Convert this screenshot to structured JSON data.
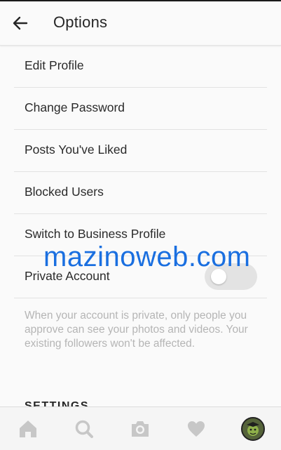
{
  "header": {
    "title": "Options",
    "back_icon": "arrow-left-icon"
  },
  "menu": {
    "items": [
      {
        "label": "Edit Profile"
      },
      {
        "label": "Change Password"
      },
      {
        "label": "Posts You've Liked"
      },
      {
        "label": "Blocked Users"
      },
      {
        "label": "Switch to Business Profile"
      }
    ],
    "private_account": {
      "label": "Private Account",
      "enabled": false
    }
  },
  "private_note": "When your account is private, only people you approve can see your photos and videos. Your existing followers won't be affected.",
  "section_header": "SETTINGS",
  "watermark": "mazinoweb.com",
  "colors": {
    "watermark": "#1a6fe0",
    "icon_gray": "#c7c7c7",
    "toggle_off": "#e3e3e3"
  },
  "bottom_nav": {
    "icons": [
      "home-icon",
      "search-icon",
      "camera-icon",
      "heart-icon",
      "profile-avatar"
    ]
  }
}
